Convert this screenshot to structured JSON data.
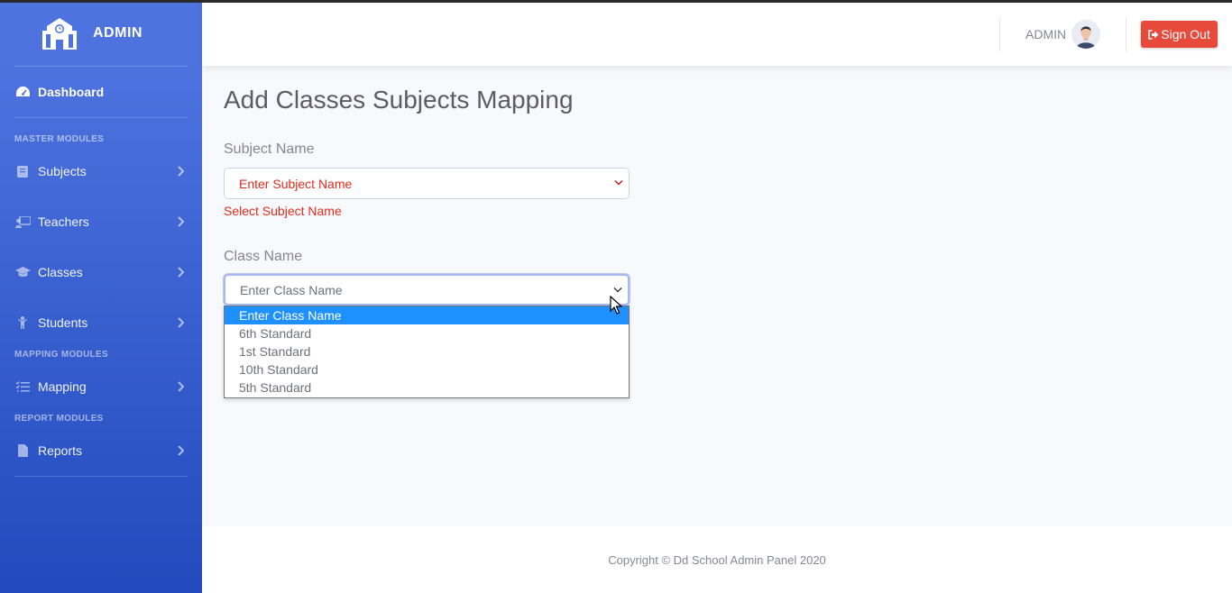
{
  "sidebar": {
    "brand": "ADMIN",
    "dashboard": "Dashboard",
    "headings": [
      "MASTER MODULES",
      "MAPPING MODULES",
      "REPORT MODULES"
    ],
    "items": [
      {
        "label": "Subjects",
        "icon": "book-icon"
      },
      {
        "label": "Teachers",
        "icon": "chalkboard-teacher-icon"
      },
      {
        "label": "Classes",
        "icon": "graduation-cap-icon"
      },
      {
        "label": "Students",
        "icon": "child-icon"
      },
      {
        "label": "Mapping",
        "icon": "list-check-icon"
      },
      {
        "label": "Reports",
        "icon": "file-icon"
      }
    ]
  },
  "topbar": {
    "user": "ADMIN",
    "signout": "Sign Out"
  },
  "main": {
    "title": "Add Classes Subjects Mapping",
    "subject_label": "Subject Name",
    "subject_value": "Enter Subject Name",
    "subject_error": "Select Subject Name",
    "class_label": "Class Name",
    "class_value": "Enter Class Name",
    "class_options": [
      "Enter Class Name",
      "6th Standard",
      "1st Standard",
      "10th Standard",
      "5th Standard"
    ]
  },
  "footer": {
    "text": "Copyright © Dd School Admin Panel 2020"
  },
  "colors": {
    "sidebar_top": "#4e73df",
    "sidebar_bottom": "#224abe",
    "danger": "#e74a3b",
    "error_text": "#e02d1b",
    "option_highlight": "#1e90ff"
  }
}
